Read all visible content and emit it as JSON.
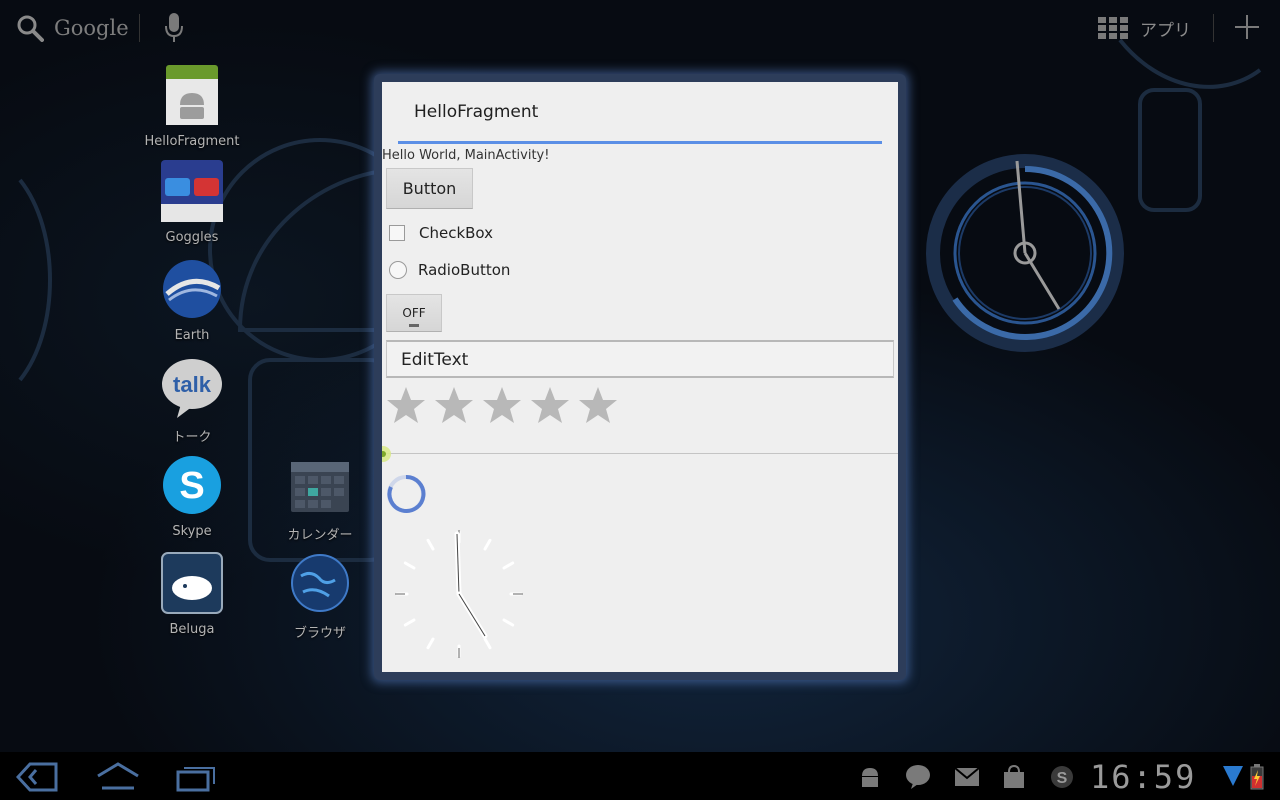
{
  "topbar": {
    "search_label": "Google",
    "apps_label": "アプリ",
    "icons": [
      "search-icon",
      "mic-icon",
      "apps-grid-icon",
      "plus-icon"
    ]
  },
  "shortcuts": [
    {
      "label": "HelloFragment",
      "icon": "android-app-icon"
    },
    {
      "label": "Goggles",
      "icon": "goggles-icon"
    },
    {
      "label": "Earth",
      "icon": "earth-icon"
    },
    {
      "label": "トーク",
      "icon": "talk-icon"
    },
    {
      "label": "Skype",
      "icon": "skype-icon"
    },
    {
      "label": "Beluga",
      "icon": "beluga-icon"
    },
    {
      "label": "カレンダー",
      "icon": "calendar-icon"
    },
    {
      "label": "ブラウザ",
      "icon": "browser-globe-icon"
    }
  ],
  "dialog": {
    "title": "HelloFragment",
    "hello_text": "Hello World, MainActivity!",
    "button_label": "Button",
    "checkbox_label": "CheckBox",
    "checkbox_checked": false,
    "radio_label": "RadioButton",
    "radio_checked": false,
    "toggle_label": "OFF",
    "edittext_value": "EditText",
    "rating": 0,
    "rating_max": 5,
    "seekbar_value": 0,
    "clock_time": "16:59"
  },
  "systembar": {
    "time": "16:59",
    "nav_icons": [
      "back-icon",
      "home-icon",
      "recent-apps-icon"
    ],
    "notification_icons": [
      "android-debug-icon",
      "talk-notification-icon",
      "gmail-icon",
      "market-icon",
      "skype-notification-icon"
    ],
    "status_icons": [
      "wifi-icon",
      "battery-icon"
    ]
  },
  "colors": {
    "accent": "#5b8fe6",
    "dialog_background": "#efefef",
    "desktop_background": "#070b12",
    "systembar": "#000000"
  }
}
